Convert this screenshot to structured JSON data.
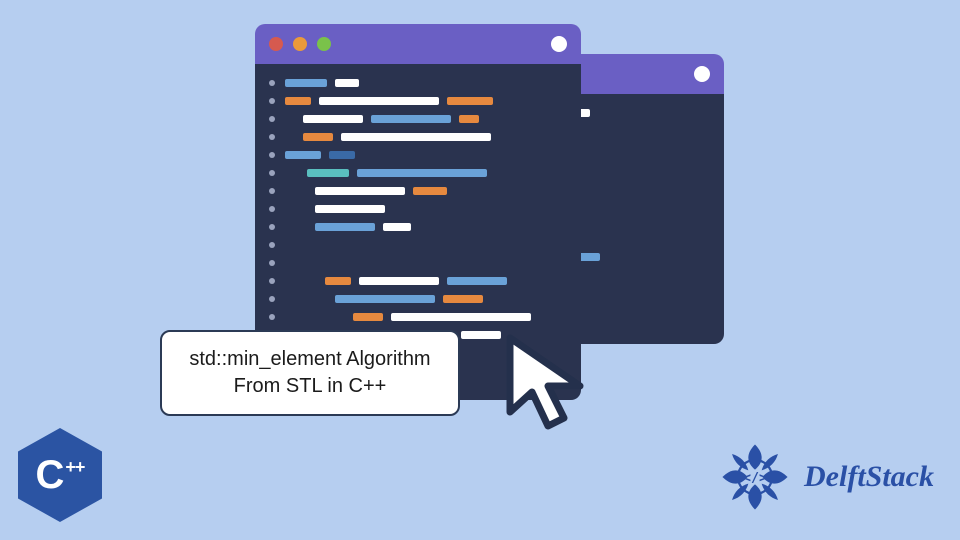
{
  "caption": {
    "line1": "std::min_element Algorithm",
    "line2": "From STL in C++"
  },
  "cpp_badge": {
    "letter": "C",
    "suffix": "++"
  },
  "brand": {
    "name": "DelftStack"
  },
  "colors": {
    "bg": "#b6cef0",
    "window_titlebar": "#6a5fc4",
    "window_body": "#2a334f",
    "accent_blue": "#2a50a6"
  },
  "windows": {
    "traffic_dots": [
      "red",
      "yellow",
      "green"
    ]
  }
}
